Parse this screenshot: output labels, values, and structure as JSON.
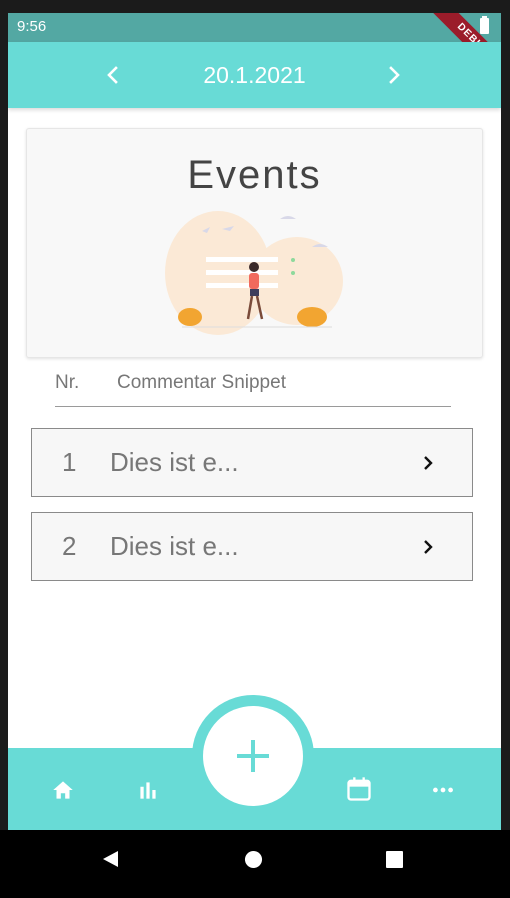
{
  "status_bar": {
    "time": "9:56",
    "debug_banner": "DEBUG"
  },
  "app_bar": {
    "date": "20.1.2021",
    "prev_icon": "chevron-left-icon",
    "next_icon": "chevron-right-icon"
  },
  "events_card": {
    "title": "Events"
  },
  "list_header": {
    "nr": "Nr.",
    "comment": "Commentar Snippet"
  },
  "items": [
    {
      "number": "1",
      "snippet": "Dies ist e..."
    },
    {
      "number": "2",
      "snippet": "Dies ist e..."
    }
  ],
  "bottom_nav": {
    "icons": [
      "home-icon",
      "bar-chart-icon",
      "add-icon",
      "calendar-icon",
      "more-icon"
    ]
  },
  "colors": {
    "accent": "#68dbd6",
    "status_bar": "#53a8a3",
    "debug": "#9b1c2a"
  }
}
